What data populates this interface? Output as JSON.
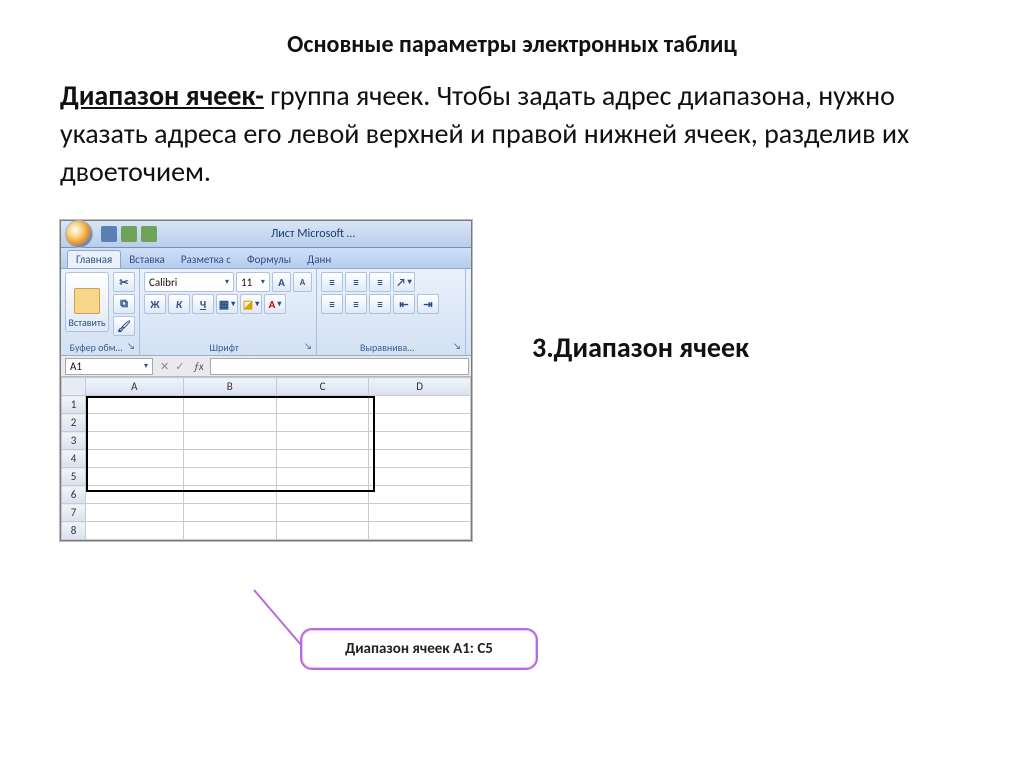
{
  "title": "Основные параметры электронных таблиц",
  "definition": {
    "term": "Диапазон ячеек-",
    "rest": " группа ячеек. Чтобы задать адрес диапазона, нужно указать адреса его левой верхней и правой нижней ячеек,  разделив их двоеточием."
  },
  "excel": {
    "window_title": "Лист Microsoft …",
    "tabs": [
      "Главная",
      "Вставка",
      "Разметка с",
      "Формулы",
      "Данн"
    ],
    "groups": {
      "clipboard": {
        "paste": "Вставить",
        "label": "Буфер обм…"
      },
      "font": {
        "name": "Calibri",
        "size": "11",
        "bold": "Ж",
        "italic": "К",
        "underline": "Ч",
        "label": "Шрифт"
      },
      "alignment": {
        "label": "Выравнива…"
      }
    },
    "namebox": "A1",
    "columns": [
      "A",
      "B",
      "C",
      "D"
    ],
    "rows": [
      "1",
      "2",
      "3",
      "4",
      "5",
      "6",
      "7",
      "8"
    ]
  },
  "side_title": "3.Диапазон ячеек",
  "callout": "Диапазон ячеек A1: C5",
  "colors": {
    "callout_border": "#ba6bd9"
  }
}
